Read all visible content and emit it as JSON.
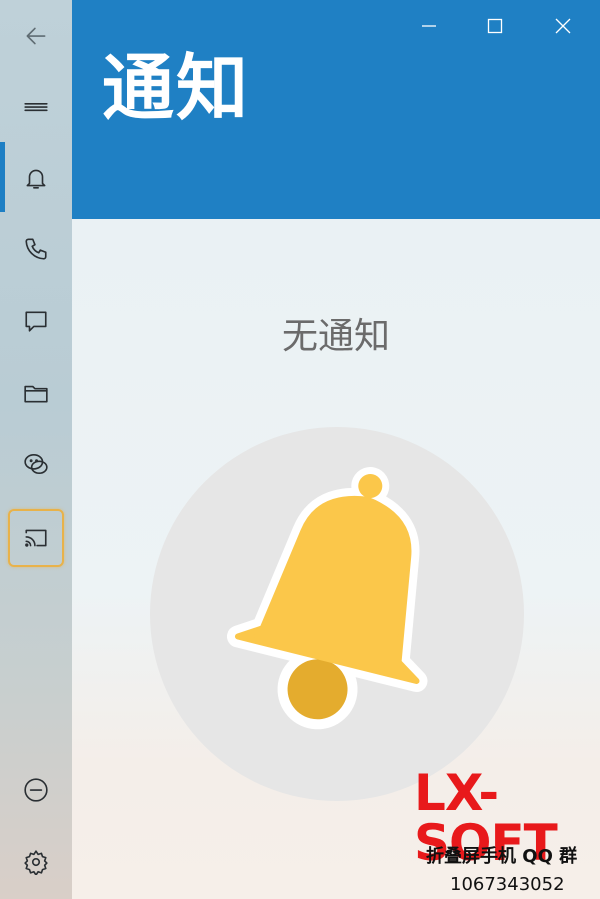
{
  "window": {
    "minimize_icon": "minimize-icon",
    "maximize_icon": "maximize-icon",
    "close_icon": "close-icon"
  },
  "sidebar": {
    "items": [
      {
        "id": "back",
        "icon": "back-arrow-icon"
      },
      {
        "id": "menu",
        "icon": "hamburger-menu-icon"
      },
      {
        "id": "notifications",
        "icon": "bell-icon",
        "active": true
      },
      {
        "id": "calls",
        "icon": "phone-icon"
      },
      {
        "id": "messages",
        "icon": "chat-bubble-icon"
      },
      {
        "id": "files",
        "icon": "folder-icon"
      },
      {
        "id": "wechat",
        "icon": "wechat-icon"
      },
      {
        "id": "cast",
        "icon": "cast-icon",
        "highlighted": true
      },
      {
        "id": "disconnect",
        "icon": "minus-circle-icon"
      },
      {
        "id": "settings",
        "icon": "gear-icon"
      }
    ]
  },
  "header": {
    "title": "通知"
  },
  "main": {
    "empty_text": "无通知",
    "illustration": "bell-illustration-icon"
  },
  "watermark": {
    "logo": "LX-SOFT",
    "line1": "折叠屏手机 QQ 群",
    "line2": "1067343052"
  },
  "colors": {
    "accent": "#1f80c4",
    "bell": "#fbc74a",
    "bell_clapper": "#e4ac2e",
    "highlight": "#e8b24a",
    "watermark_red": "#e8191b"
  }
}
